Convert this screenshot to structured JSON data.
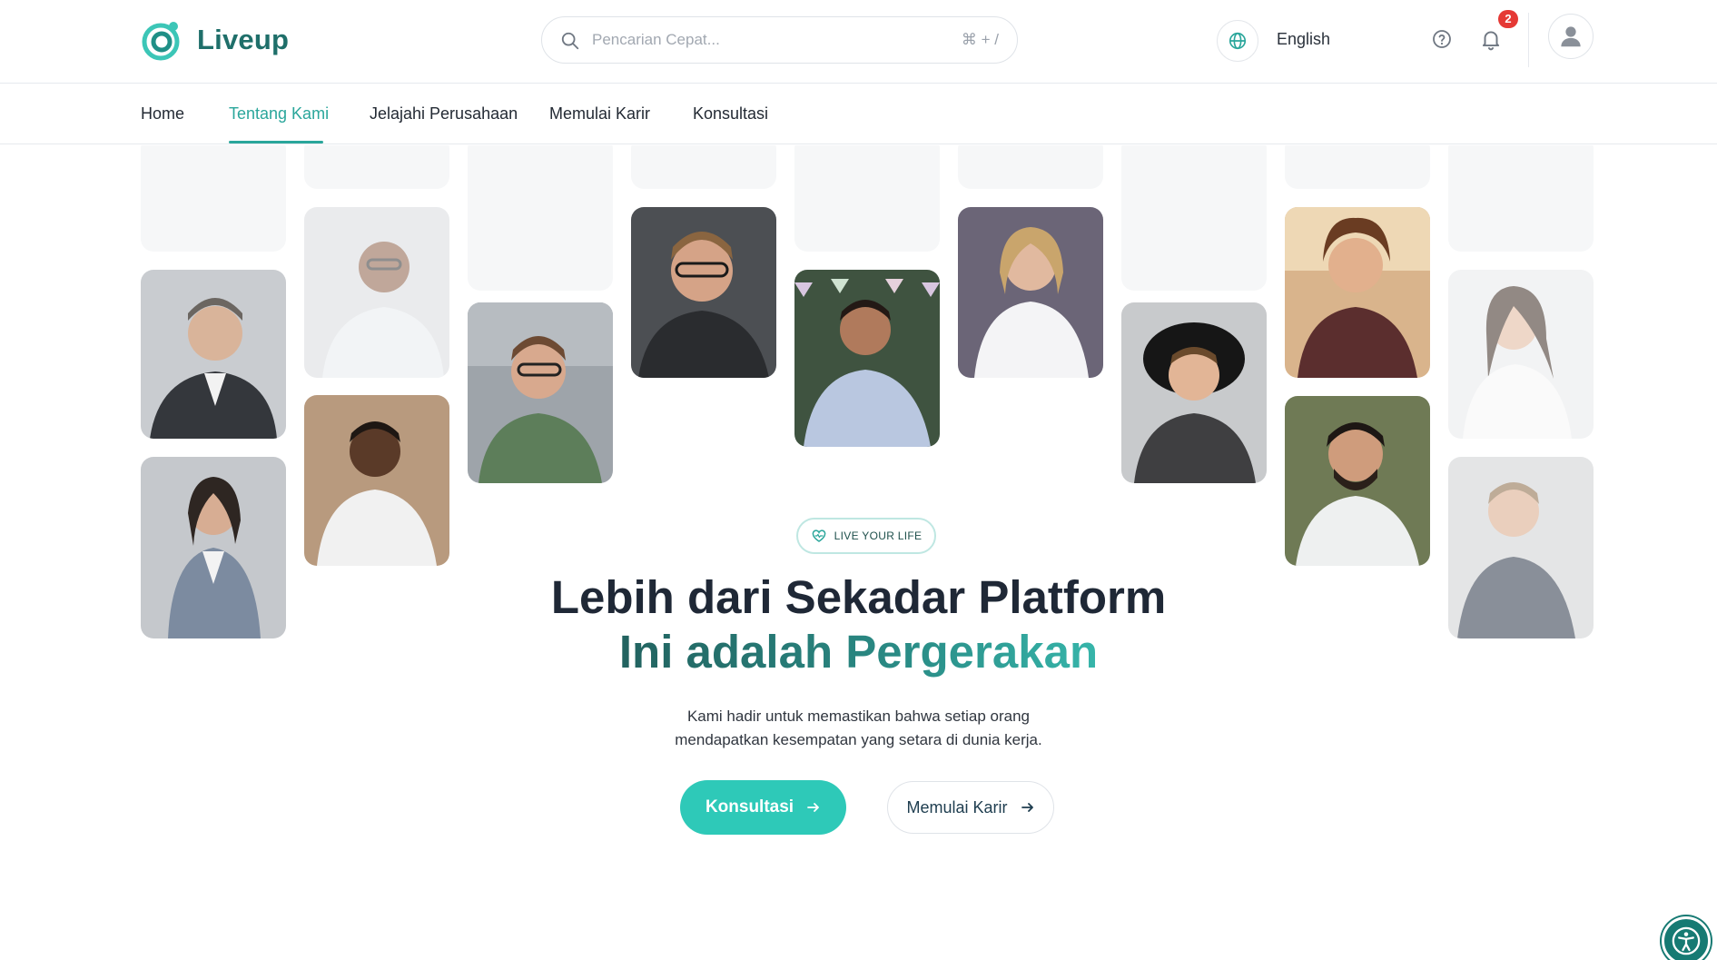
{
  "brand": {
    "name": "Liveup",
    "logo_icon": "liveup-logo-icon",
    "accent": "#2aa69b",
    "primary_button": "#2ec9b8"
  },
  "search": {
    "placeholder": "Pencarian Cepat...",
    "shortcut": "⌘ + /"
  },
  "header": {
    "language": "English",
    "language_icon": "globe-icon",
    "help_icon": "help-circle-icon",
    "notification_icon": "bell-icon",
    "notification_count": "2",
    "avatar_icon": "user-avatar-icon"
  },
  "nav": {
    "items": [
      {
        "label": "Home",
        "active": false
      },
      {
        "label": "Tentang Kami",
        "active": true
      },
      {
        "label": "Jelajahi Perusahaan",
        "active": false
      },
      {
        "label": "Memulai Karir",
        "active": false
      },
      {
        "label": "Konsultasi",
        "active": false
      }
    ]
  },
  "hero": {
    "badge": "LIVE YOUR LIFE",
    "badge_icon": "heart-pulse-icon",
    "title": "Lebih dari Sekadar Platform",
    "subtitle": "Ini adalah Pergerakan",
    "description_line1": "Kami hadir untuk memastikan bahwa setiap orang",
    "description_line2": "mendapatkan kesempatan yang setara di dunia kerja.",
    "primary_cta": "Konsultasi",
    "secondary_cta": "Memulai Karir"
  },
  "accessibility": {
    "icon": "accessibility-icon"
  }
}
